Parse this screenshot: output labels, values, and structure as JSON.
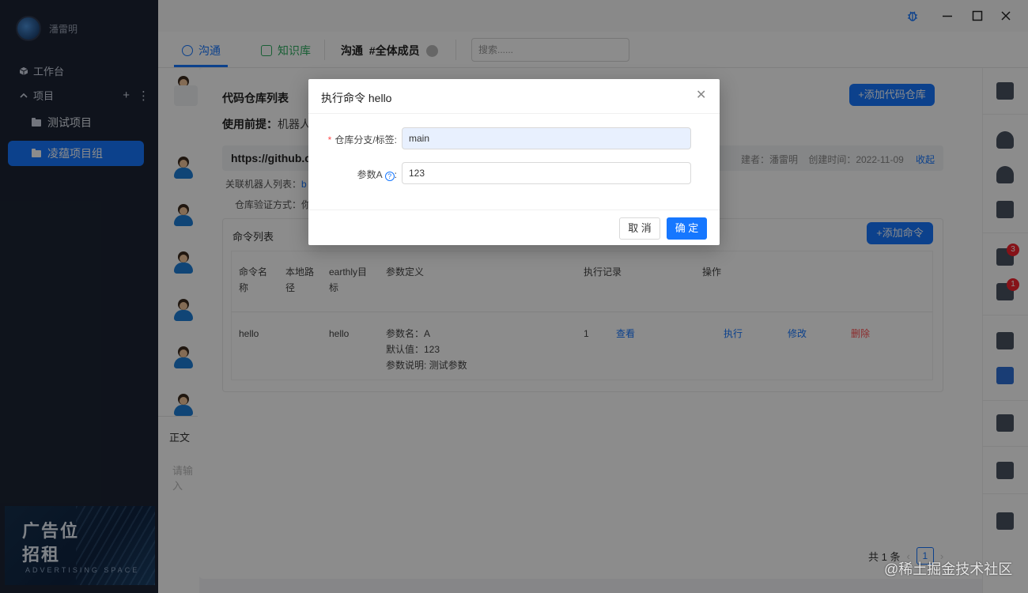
{
  "sidebar": {
    "username": "潘雷明",
    "workbench": "工作台",
    "projects_label": "项目",
    "items": [
      {
        "label": "测试项目"
      },
      {
        "label": "凌蕴项目组"
      }
    ],
    "ad": {
      "line1": "广告位",
      "line2": "招租",
      "line3": "ADVERTISING SPACE"
    }
  },
  "header": {
    "tabs": [
      {
        "label": "沟通",
        "icon": "chat-icon",
        "active": true
      },
      {
        "label": "知识库",
        "icon": "book-icon",
        "active": false
      }
    ],
    "channel": "沟通  #全体成员",
    "search": {
      "placeholder": "搜索......"
    }
  },
  "chat": {
    "editor_label": "正文",
    "editor_placeholder": "请输入"
  },
  "panel": {
    "title": "代码仓库列表",
    "add_repo_label": "+添加代码仓库",
    "prereq_label": "使用前提：",
    "prereq_text": "机器人",
    "repo": {
      "url": "https://github.c",
      "meta": "建者：潘雷明    创建时间：2022-11-09",
      "collapse_label": "收起"
    },
    "bots_label": "关联机器人列表：",
    "bots_value": "b",
    "auth_label": "仓库验证方式：你",
    "commands": {
      "title": "命令列表",
      "add_label": "+添加命令",
      "headers": [
        "命令名称",
        "本地路径",
        "earthly目标",
        "参数定义",
        "执行记录",
        "操作"
      ],
      "rows": [
        {
          "name": "hello",
          "path": "",
          "target": "hello",
          "param_name": "参数名：A",
          "param_default": "默认值：123",
          "param_desc": "参数说明: 测试参数",
          "exec_count": "1",
          "view": "查看",
          "actions": [
            "执行",
            "修改",
            "删除"
          ]
        }
      ]
    },
    "pagination": {
      "total": "共 1 条",
      "page": "1"
    }
  },
  "rail": {
    "badges": [
      "3",
      "1"
    ]
  },
  "modal": {
    "title": "执行命令 hello",
    "fields": [
      {
        "label": "仓库分支/标签:",
        "value": "main",
        "required": true
      },
      {
        "label": "参数A",
        "value": "123",
        "required": false
      }
    ],
    "cancel_label": "取 消",
    "ok_label": "确 定"
  },
  "watermark": "@稀土掘金技术社区",
  "colors": {
    "primary": "#1677ff",
    "danger": "#ff4d4f",
    "sidebar_bg": "#1c2433"
  }
}
